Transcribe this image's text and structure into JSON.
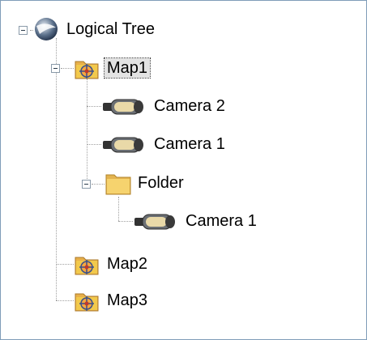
{
  "tree": {
    "root": {
      "label": "Logical Tree",
      "icon": "globe-icon",
      "expanded": true
    },
    "nodes": [
      {
        "label": "Map1",
        "icon": "map-folder-icon",
        "expanded": true,
        "selected": true
      },
      {
        "label": "Camera 2",
        "icon": "camera-icon"
      },
      {
        "label": "Camera 1",
        "icon": "camera-icon"
      },
      {
        "label": "Folder",
        "icon": "folder-icon",
        "expanded": true
      },
      {
        "label": "Camera 1",
        "icon": "camera-icon"
      },
      {
        "label": "Map2",
        "icon": "map-folder-icon"
      },
      {
        "label": "Map3",
        "icon": "map-folder-icon"
      }
    ]
  },
  "colors": {
    "selection_bg": "#e3e3e3",
    "folder": "#f2c94c",
    "border": "#7f9db9"
  }
}
